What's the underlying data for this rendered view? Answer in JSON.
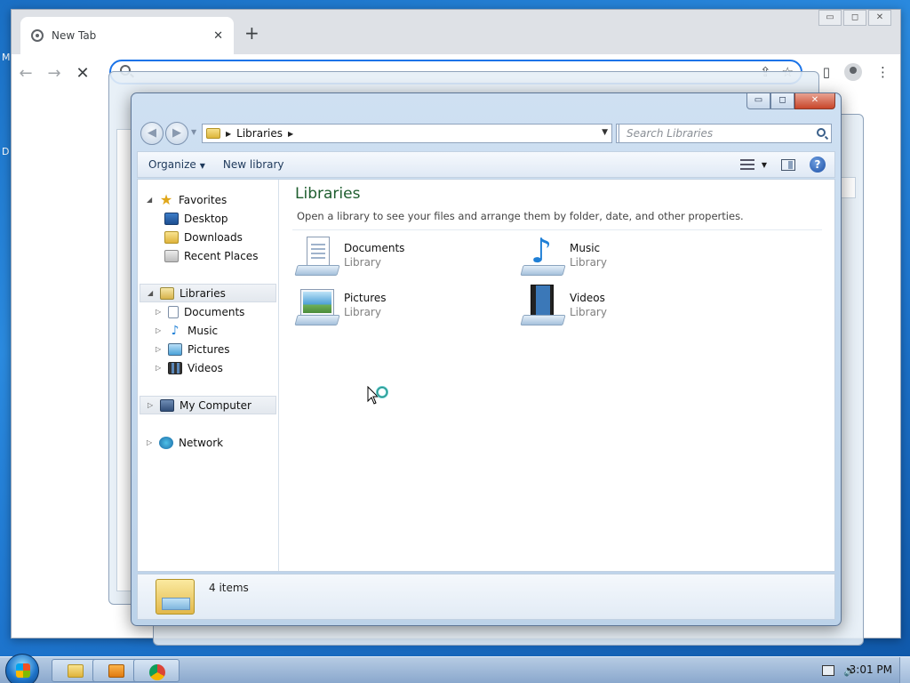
{
  "desktop": {
    "edge_labels": [
      "M",
      "D"
    ]
  },
  "chrome": {
    "tab_title": "New Tab",
    "new_tab_symbol": "+",
    "back_symbol": "←",
    "forward_symbol": "→",
    "stop_symbol": "✕",
    "omnibox_value": "",
    "window_controls": {
      "minimize": "▭",
      "maximize": "◻",
      "close": "✕"
    }
  },
  "explorer": {
    "window_controls": {
      "minimize": "▭",
      "maximize": "◻",
      "close": "✕"
    },
    "address": {
      "crumbs": [
        "Libraries"
      ]
    },
    "search_placeholder": "Search Libraries",
    "commands": {
      "organize": "Organize",
      "new_library": "New library"
    },
    "nav": {
      "favorites": "Favorites",
      "favorites_items": [
        "Desktop",
        "Downloads",
        "Recent Places"
      ],
      "libraries": "Libraries",
      "libraries_items": [
        "Documents",
        "Music",
        "Pictures",
        "Videos"
      ],
      "computer": "My Computer",
      "network": "Network"
    },
    "content": {
      "title": "Libraries",
      "subtitle": "Open a library to see your files and arrange them by folder, date, and other properties.",
      "tiles": [
        {
          "name": "Documents",
          "type": "Library",
          "icon": "documents-library-icon"
        },
        {
          "name": "Music",
          "type": "Library",
          "icon": "music-library-icon"
        },
        {
          "name": "Pictures",
          "type": "Library",
          "icon": "pictures-library-icon"
        },
        {
          "name": "Videos",
          "type": "Library",
          "icon": "videos-library-icon"
        }
      ]
    },
    "details": {
      "item_count": "4 items"
    }
  },
  "taskbar": {
    "clock": "3:01 PM",
    "pinned": [
      "file-explorer",
      "media-player",
      "chrome"
    ]
  },
  "colors": {
    "accent": "#1a73e8",
    "library_title": "#1e5d2e",
    "taskbar": "#9fb9d9"
  }
}
